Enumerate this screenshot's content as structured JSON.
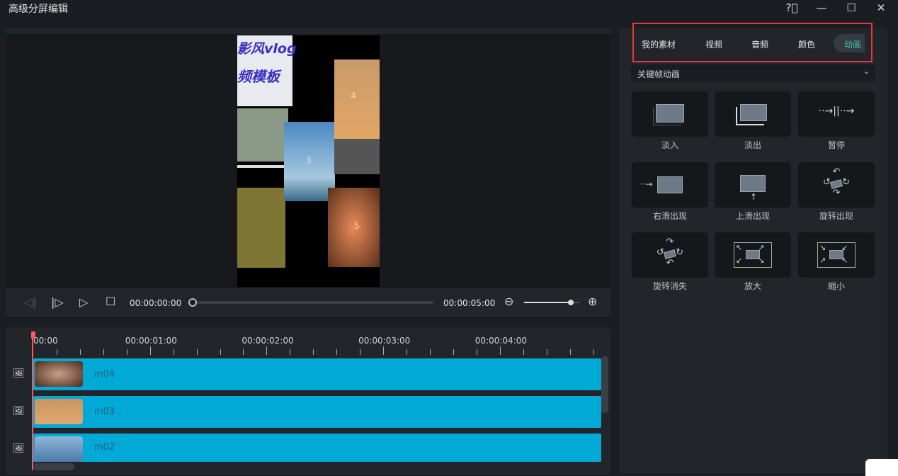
{
  "window": {
    "title": "高级分屏编辑",
    "help_icon": "question-circle-icon",
    "minimize_icon": "minimize-icon",
    "maximize_icon": "maximize-icon",
    "close_icon": "close-icon"
  },
  "preview": {
    "overlay_text_1": "影风vlog",
    "overlay_text_2": "频模板",
    "numbers": [
      "4",
      "3",
      "5"
    ]
  },
  "controls": {
    "current_time": "00:00:00:00",
    "total_time": "00:00:05:00",
    "progress": 0,
    "zoom_level": 0.85
  },
  "timeline": {
    "ruler": [
      "00:00",
      "00:00:01:00",
      "00:00:02:00",
      "00:00:03:00",
      "00:00:04:00"
    ],
    "tracks": [
      {
        "name": "m04"
      },
      {
        "name": "m03"
      },
      {
        "name": "m02"
      }
    ],
    "accent": "#00a9d6",
    "playhead_color": "#ff5a5a"
  },
  "right": {
    "tabs": [
      "我的素材",
      "视频",
      "音频",
      "颜色",
      "动画"
    ],
    "active_tab": "动画",
    "active_color": "#3ec6a8",
    "dropdown": "关键帧动画",
    "animations": [
      "淡入",
      "淡出",
      "暂停",
      "右滑出现",
      "上滑出现",
      "旋转出现",
      "旋转消失",
      "放大",
      "缩小"
    ]
  }
}
